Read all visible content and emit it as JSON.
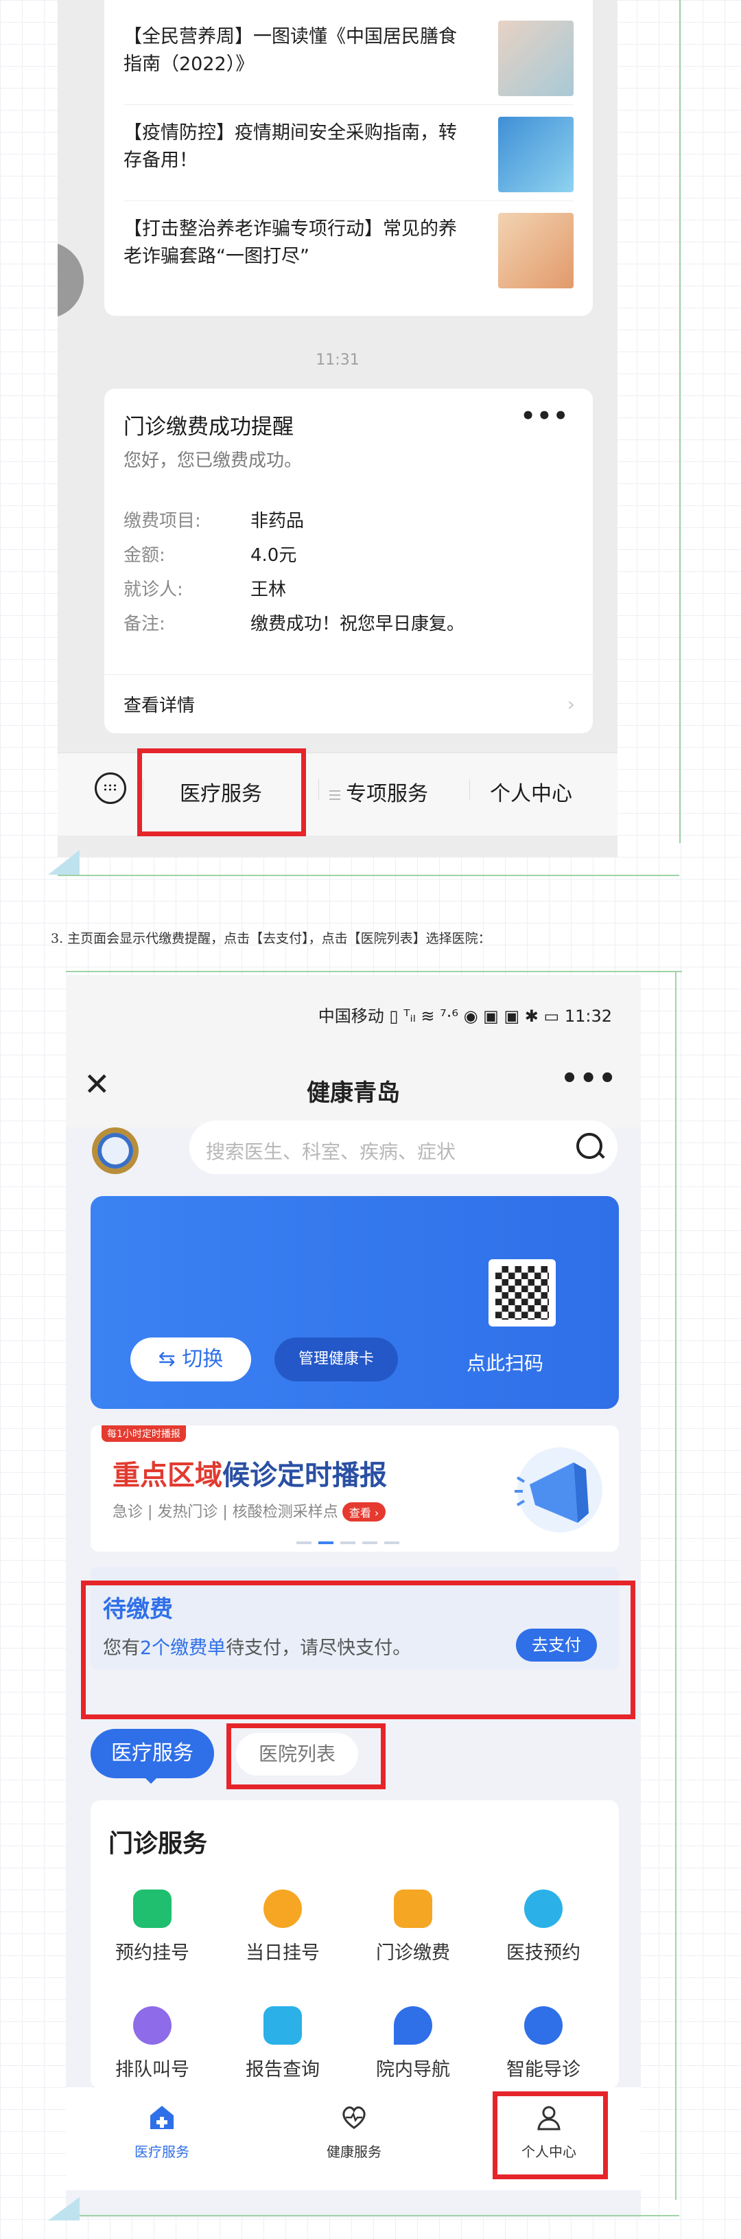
{
  "shot1": {
    "news": [
      "【全民营养周】一图读懂《中国居民膳食指南（2022）》",
      "【疫情防控】疫情期间安全采购指南，转存备用！",
      "【打击整治养老诈骗专项行动】常见的养老诈骗套路“一图打尽”"
    ],
    "time": "11:31",
    "card": {
      "title": "门诊缴费成功提醒",
      "more": "•••",
      "subtitle": "您好，您已缴费成功。",
      "rows": [
        {
          "k": "缴费项目:",
          "v": "非药品"
        },
        {
          "k": "金额:",
          "v": "4.0元"
        },
        {
          "k": "就诊人:",
          "v": "王林"
        },
        {
          "k": "备注:",
          "v": "缴费成功！祝您早日康复。"
        }
      ],
      "detail": "查看详情",
      "chevron": "›"
    },
    "menu": [
      "医疗服务",
      "专项服务",
      "个人中心"
    ]
  },
  "caption": "3. 主页面会显示代缴费提醒，点击【去支付】，点击【医院列表】选择医院：",
  "shot2": {
    "status": "中国移动 ▯ ᵀᵢₗ ≋ ⁷·⁶ ◉ ▣ ▣ ✱ ▭ 11:32",
    "nav": {
      "close": "✕",
      "title": "健康青岛",
      "more": "•••"
    },
    "search_placeholder": "搜索医生、科室、疾病、症状",
    "card": {
      "switch": "⇆ 切换",
      "manage": "管理健康卡",
      "scan": "点此扫码"
    },
    "banner": {
      "tag": "每1小时定时播报",
      "title_red": "重点区域",
      "title_blue": "候诊定时播报",
      "sub": "急诊 | 发热门诊 | 核酸检测采样点",
      "btn": "查看 ›"
    },
    "pay": {
      "title": "待缴费",
      "sub_pre": "您有",
      "sub_link": "2个缴费单",
      "sub_post": "待支付，请尽快支付。",
      "btn": "去支付"
    },
    "tabs": [
      "医疗服务",
      "医院列表"
    ],
    "service_title": "门诊服务",
    "services": [
      {
        "label": "预约挂号",
        "color": "#1fbf6f"
      },
      {
        "label": "当日挂号",
        "color": "#f6a623"
      },
      {
        "label": "门诊缴费",
        "color": "#f5a623"
      },
      {
        "label": "医技预约",
        "color": "#2bb1e8"
      },
      {
        "label": "排队叫号",
        "color": "#8e6be8"
      },
      {
        "label": "报告查询",
        "color": "#2bb1e8"
      },
      {
        "label": "院内导航",
        "color": "#2f6fe8"
      },
      {
        "label": "智能导诊",
        "color": "#2f6fe8"
      }
    ],
    "tabbar": [
      "医疗服务",
      "健康服务",
      "个人中心"
    ]
  },
  "colors": {
    "accent": "#2f6fe8",
    "highlight": "#e5252a"
  }
}
